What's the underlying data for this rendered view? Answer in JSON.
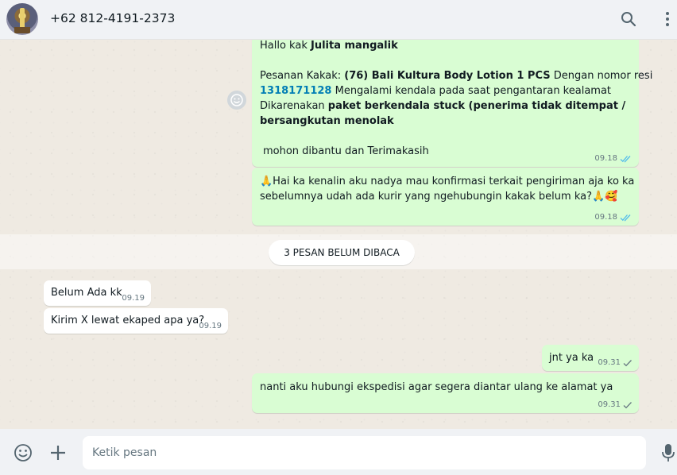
{
  "header": {
    "contact_name": "+62 812-4191-2373"
  },
  "messages": {
    "m1": {
      "greeting_prefix": "Hallo kak ",
      "greeting_name": "Julita mangalik",
      "order_label": "Pesanan Kakak: ",
      "order_item": "(76) Bali Kultura Body Lotion 1 PCS",
      "order_mid": " Dengan nomor resi",
      "resi": "1318171128",
      "issue": " Mengalami kendala pada saat pengantaran kealamat",
      "reason_prefix": "Dikarenakan ",
      "reason_bold_1": "paket berkendala stuck (penerima tidak ditempat /",
      "reason_bold_2": "bersangkutan menolak",
      "closing": "mohon dibantu dan Terimakasih",
      "time": "09.18"
    },
    "m2": {
      "line1": "🙏Hai ka kenalin aku nadya mau konfirmasi terkait pengiriman aja ko ka",
      "line2": "sebelumnya udah ada kurir yang ngehubungin kakak belum ka?🙏🥰",
      "time": "09.18"
    },
    "unread_label": "3 PESAN BELUM DIBACA",
    "m3": {
      "text": "Belum Ada kk",
      "time": "09.19"
    },
    "m4": {
      "text": "Kirim X lewat ekaped apa ya?",
      "time": "09.19"
    },
    "m5": {
      "text": "jnt ya ka",
      "time": "09.31"
    },
    "m6": {
      "text": "nanti aku hubungi ekspedisi agar segera diantar ulang ke alamat ya",
      "time": "09.31"
    }
  },
  "composer": {
    "placeholder": "Ketik pesan"
  },
  "icons": {
    "search": "search-icon",
    "menu": "menu-dots-icon",
    "emoji": "emoji-icon",
    "attach": "plus-icon",
    "mic": "mic-icon",
    "forward": "forward-emoji-icon"
  },
  "colors": {
    "outgoing_bubble": "#d9fdd3",
    "incoming_bubble": "#ffffff",
    "read_ticks": "#53bdeb",
    "resi_link": "#027eb5"
  }
}
